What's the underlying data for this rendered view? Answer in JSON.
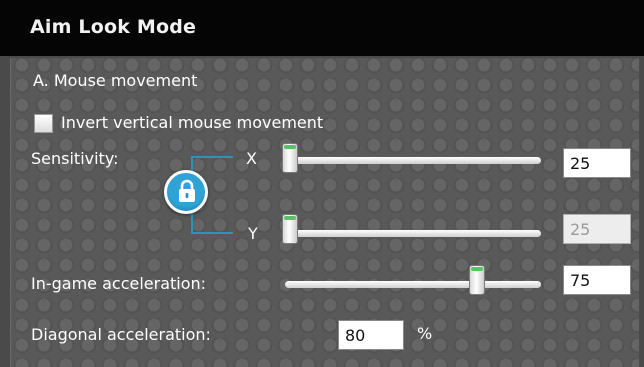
{
  "window": {
    "title": "Aim Look Mode"
  },
  "mouse": {
    "section_label": "A. Mouse movement",
    "invert_vertical": {
      "label": "Invert vertical mouse movement",
      "checked": false
    },
    "sensitivity": {
      "label": "Sensitivity:",
      "lock_icon": "padlock-icon",
      "locked": true,
      "x": {
        "axis_label": "X",
        "value": "25",
        "slider_fraction": 0.0
      },
      "y": {
        "axis_label": "Y",
        "value": "25",
        "slider_fraction": 0.0,
        "disabled": true
      }
    },
    "ingame_acceleration": {
      "label": "In-game acceleration:",
      "value": "75",
      "slider_fraction": 0.75
    },
    "diagonal_acceleration": {
      "label": "Diagonal acceleration:",
      "value": "80",
      "unit": "%"
    }
  },
  "colors": {
    "title_bar": "#050505",
    "panel": "#595959",
    "accent_blue": "#2a93c2",
    "slider_tab_green": "#56c26a"
  }
}
